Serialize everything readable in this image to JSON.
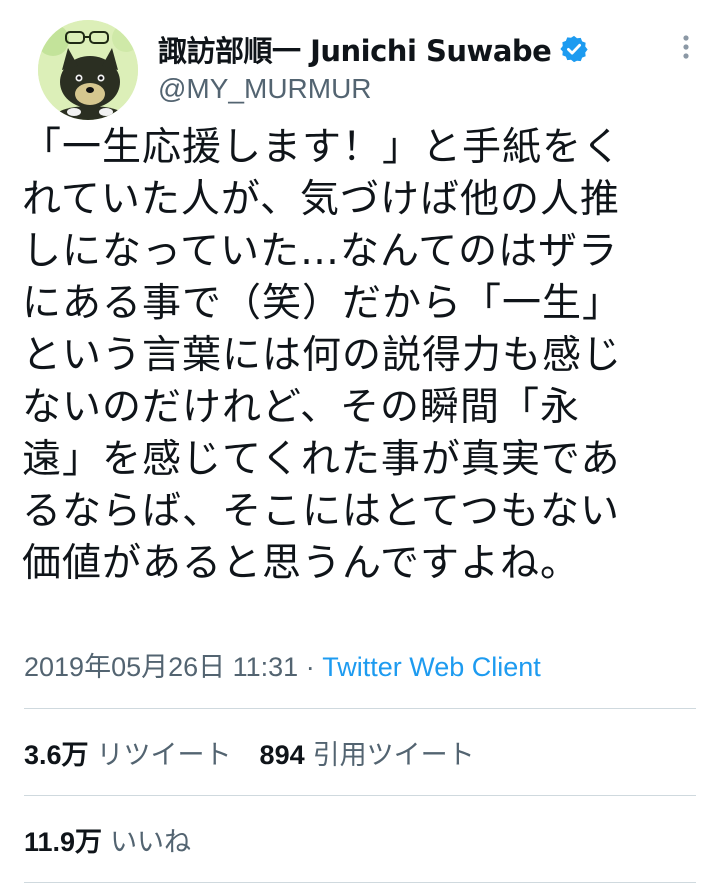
{
  "user": {
    "display_name": "諏訪部順一 Junichi Suwabe",
    "handle": "@MY_MURMUR",
    "verified_icon": "verified-badge-icon"
  },
  "tweet": {
    "lines": [
      "「一生応援します！」と手紙をく",
      "れていた人が、気づけば他の人推",
      "しになっていた…なんてのはザラ",
      "にある事で（笑）だから「一生」",
      "という言葉には何の説得力も感じ",
      "ないのだけれど、その瞬間「永",
      "遠」を感じてくれた事が真実であ",
      "るならば、そこにはとてつもない",
      "価値があると思うんですよね。"
    ],
    "timestamp": "2019年05月26日 11:31",
    "separator": " · ",
    "source": "Twitter Web Client"
  },
  "stats": {
    "retweets_count": "3.6万",
    "retweets_label": "リツイート",
    "quotes_count": "894",
    "quotes_label": "引用ツイート",
    "likes_count": "11.9万",
    "likes_label": "いいね"
  },
  "colors": {
    "text": "#0f1419",
    "secondary": "#536471",
    "accent": "#1d9bf0",
    "divider": "#cfd9de"
  }
}
